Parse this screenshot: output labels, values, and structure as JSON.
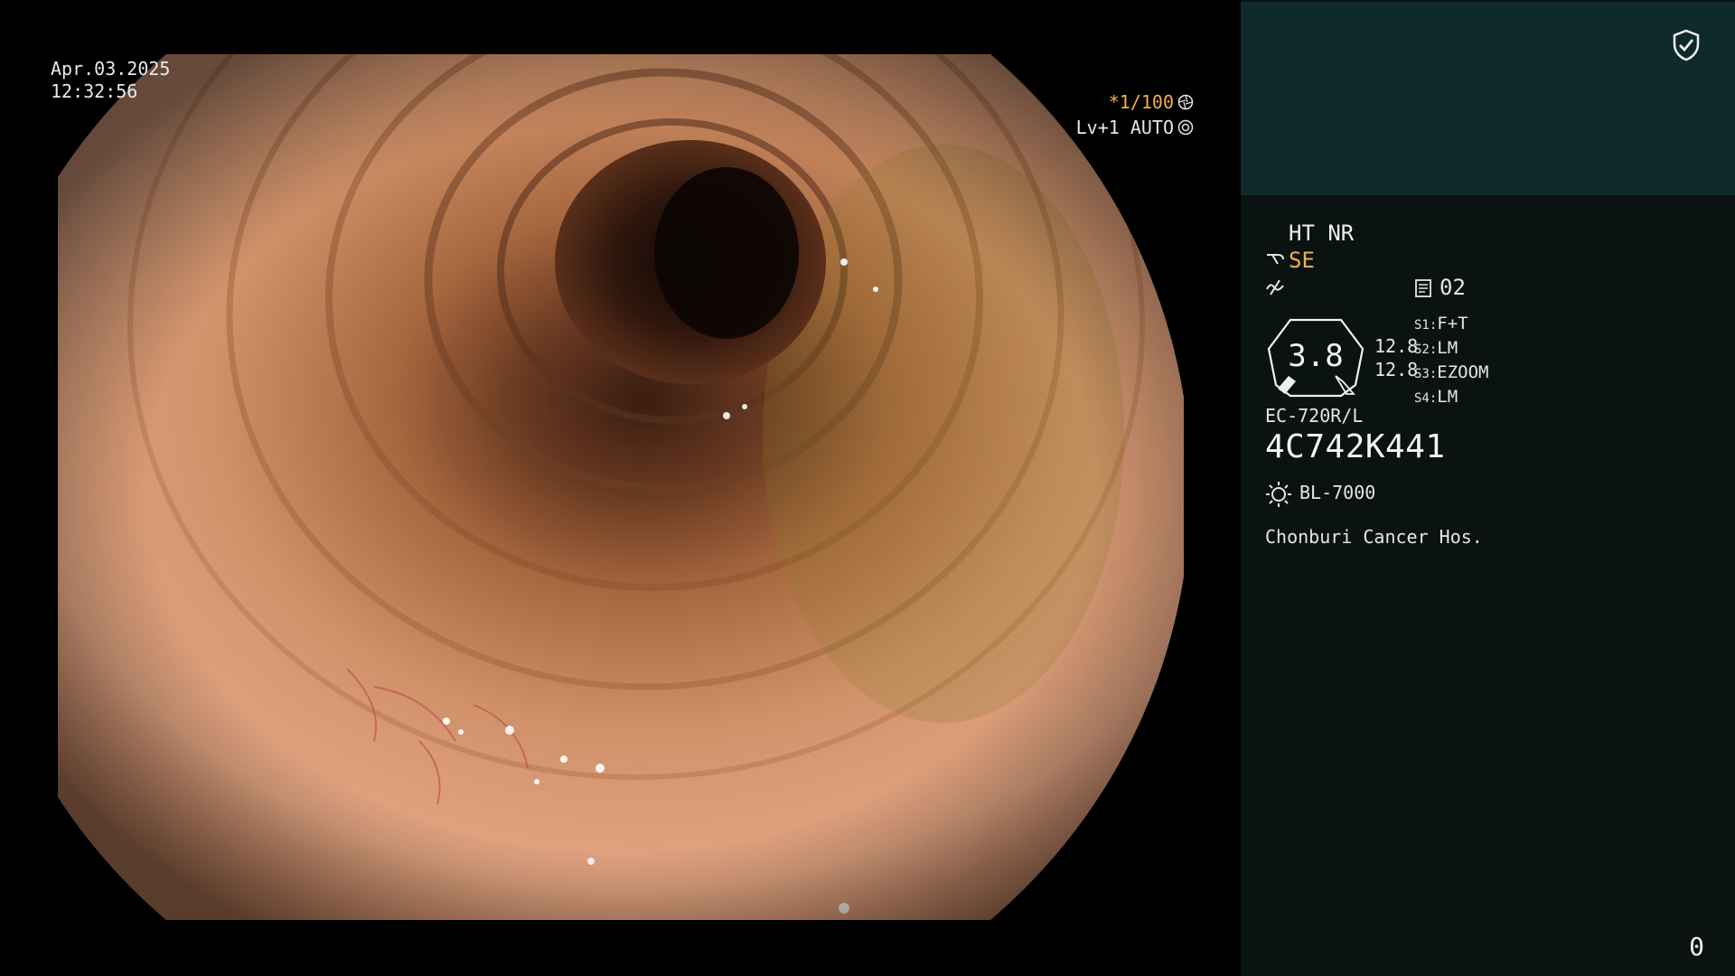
{
  "view": {
    "date": "Apr.03.2025",
    "time": "12:32:56",
    "shutter": "*1/100",
    "level_mode": "Lv+1 AUTO",
    "image_subject": "colon lumen endoscopic view"
  },
  "panel": {
    "icons": [
      "shield-check-icon",
      "scope-tip-icon",
      "wave-icon",
      "document-icon",
      "light-source-icon"
    ],
    "modes": "HT NR",
    "se_mode": "SE",
    "doc_value": "02",
    "gauge": {
      "value": "3.8",
      "upper": "12.8",
      "lower": "12.8"
    },
    "slots": [
      {
        "key": "S1",
        "value": "F+T"
      },
      {
        "key": "S2",
        "value": "LM"
      },
      {
        "key": "S3",
        "value": "EZOOM"
      },
      {
        "key": "S4",
        "value": "LM"
      }
    ],
    "scope_model": "EC-720R/L",
    "scope_serial": "4C742K441",
    "light_source": "BL-7000",
    "hospital": "Chonburi Cancer Hos.",
    "counter": "0"
  },
  "colors": {
    "panel_bg": "#0a1212",
    "panel_top_bg": "#0f2a2b",
    "highlight": "#f0b04a",
    "text": "#e6e6e6"
  }
}
